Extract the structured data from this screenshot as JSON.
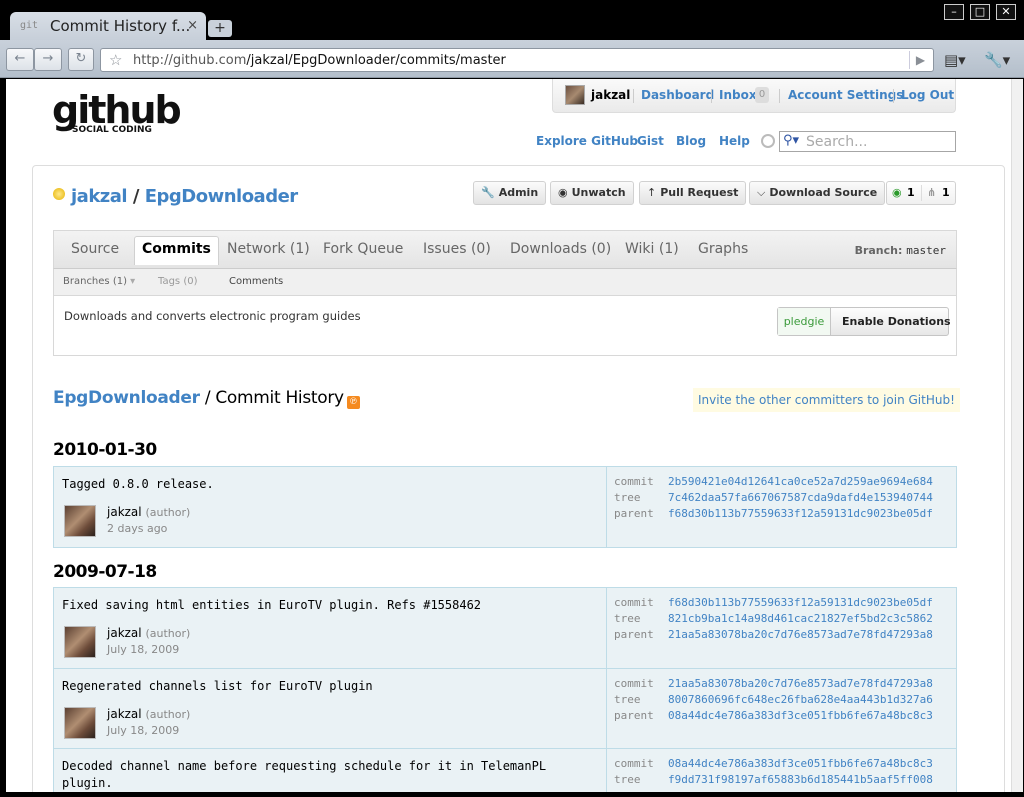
{
  "browser": {
    "tab_favicon": "git",
    "tab_title": "Commit History f...",
    "tab_close": "×",
    "new_tab": "+",
    "window_controls": [
      "–",
      "□",
      "✕"
    ],
    "back_icon": "back-arrow-icon",
    "forward_icon": "forward-arrow-icon",
    "reload_icon": "reload-icon",
    "url_host": "http://github.com",
    "url_path": "/jakzal/EpgDownloader/commits/master",
    "go_icon": "play-arrow-icon",
    "page_menu_icon": "page-icon",
    "wrench_menu_icon": "wrench-icon"
  },
  "header": {
    "logo_main": "github",
    "logo_sub": "SOCIAL CODING",
    "user": "jakzal",
    "dashboard": "Dashboard",
    "inbox": "Inbox",
    "inbox_count": "0",
    "account_settings": "Account Settings",
    "logout": "Log Out",
    "explore": "Explore GitHub",
    "gist": "Gist",
    "blog": "Blog",
    "help": "Help",
    "search_placeholder": "Search..."
  },
  "repo": {
    "owner": "jakzal",
    "separator": " / ",
    "name": "EpgDownloader",
    "buttons": {
      "admin": "Admin",
      "unwatch": "Unwatch",
      "pull_request": "Pull Request",
      "download_source": "Download Source"
    },
    "watchers": "1",
    "forks": "1",
    "tabs": [
      {
        "label": "Source"
      },
      {
        "label": "Commits"
      },
      {
        "label": "Network (1)"
      },
      {
        "label": "Fork Queue"
      },
      {
        "label": "Issues (0)"
      },
      {
        "label": "Downloads (0)"
      },
      {
        "label": "Wiki (1)"
      },
      {
        "label": "Graphs"
      }
    ],
    "branch_label": "Branch:",
    "branch_value": "master",
    "subtabs": {
      "branches": "Branches (1)",
      "tags": "Tags (0)",
      "comments": "Comments"
    },
    "description": "Downloads and converts electronic program guides",
    "pledgie_logo": "pledgie",
    "pledgie_label": "Enable Donations"
  },
  "history": {
    "repo": "EpgDownloader",
    "suffix": " / Commit History",
    "invite": "Invite the other committers to join GitHub!",
    "days": [
      "2010-01-30",
      "2009-07-18"
    ],
    "meta_labels": {
      "commit": "commit",
      "tree": "tree",
      "parent": "parent"
    },
    "commits": [
      {
        "message": "Tagged 0.8.0 release.",
        "author": "jakzal",
        "role": "(author)",
        "date": "2 days ago",
        "commit": "2b590421e04d12641ca0ce52a7d259ae9694e684",
        "tree": "7c462daa57fa667067587cda9dafd4e153940744",
        "parent": "f68d30b113b77559633f12a59131dc9023be05df"
      },
      {
        "message": "Fixed saving html entities in EuroTV plugin. Refs #1558462",
        "author": "jakzal",
        "role": "(author)",
        "date": "July 18, 2009",
        "commit": "f68d30b113b77559633f12a59131dc9023be05df",
        "tree": "821cb9ba1c14a98d461cac21827ef5bd2c3c5862",
        "parent": "21aa5a83078ba20c7d76e8573ad7e78fd47293a8"
      },
      {
        "message": "Regenerated channels list for EuroTV plugin",
        "author": "jakzal",
        "role": "(author)",
        "date": "July 18, 2009",
        "commit": "21aa5a83078ba20c7d76e8573ad7e78fd47293a8",
        "tree": "8007860696fc648ec26fba628e4aa443b1d327a6",
        "parent": "08a44dc4e786a383df3ce051fbb6fe67a48bc8c3"
      },
      {
        "message": "Decoded channel name before requesting schedule for it in TelemanPL plugin.",
        "commit": "08a44dc4e786a383df3ce051fbb6fe67a48bc8c3",
        "tree": "f9dd731f98197af65883b6d185441b5aaf5ff008"
      }
    ]
  }
}
